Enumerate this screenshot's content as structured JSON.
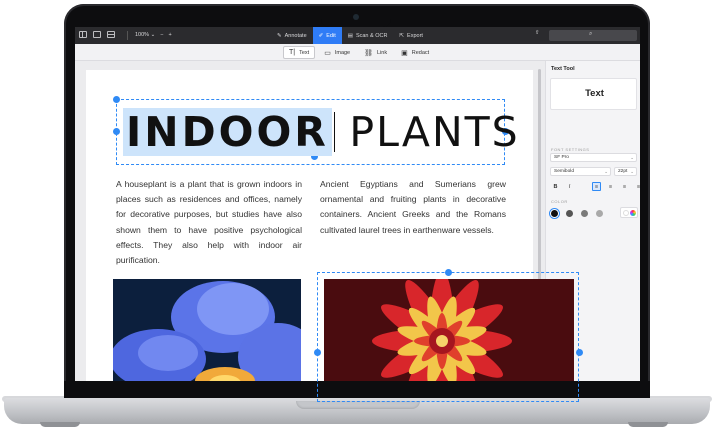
{
  "toolbar": {
    "zoom": "100%",
    "zoom_minus": "−",
    "zoom_plus": "+",
    "tabs": [
      {
        "label": "Annotate",
        "icon": "annotate-icon"
      },
      {
        "label": "Edit",
        "icon": "edit-icon",
        "active": true
      },
      {
        "label": "Scan & OCR",
        "icon": "scan-icon"
      },
      {
        "label": "Export",
        "icon": "export-icon"
      }
    ],
    "search_icon": "⌕",
    "accent_color": "#2f7cf6"
  },
  "edit_tools": [
    {
      "label": "Text",
      "icon": "text-tool-icon",
      "active": true
    },
    {
      "label": "Image",
      "icon": "image-tool-icon"
    },
    {
      "label": "Link",
      "icon": "link-tool-icon"
    },
    {
      "label": "Redact",
      "icon": "redact-tool-icon"
    }
  ],
  "document": {
    "title_bold": "INDOOR",
    "title_light": "PLANTS",
    "col1": "A houseplant is a plant that is grown indoors in places such as residences and offices, namely for decorative purposes, but studies have also shown them to have positive psychological effects. They also help with indoor air purification.",
    "col2": "Ancient Egyptians and Sumerians grew ornamental and fruiting plants in decorative containers. Ancient Greeks and the Romans cultivated laurel trees in earthenware vessels.",
    "images": [
      "blue-flower-image",
      "red-yellow-dahlia-image"
    ]
  },
  "panel": {
    "title": "Text Tool",
    "preview": "Text",
    "font_settings_label": "FONT SETTINGS",
    "font_family": "SF Pro",
    "font_weight": "Semibold",
    "font_size": "22pt",
    "bold": "B",
    "italic": "I",
    "color_label": "COLOR",
    "colors": [
      "#111111",
      "#555555",
      "#7a7a7a",
      "#a9a9a9",
      "#ffffff"
    ]
  }
}
